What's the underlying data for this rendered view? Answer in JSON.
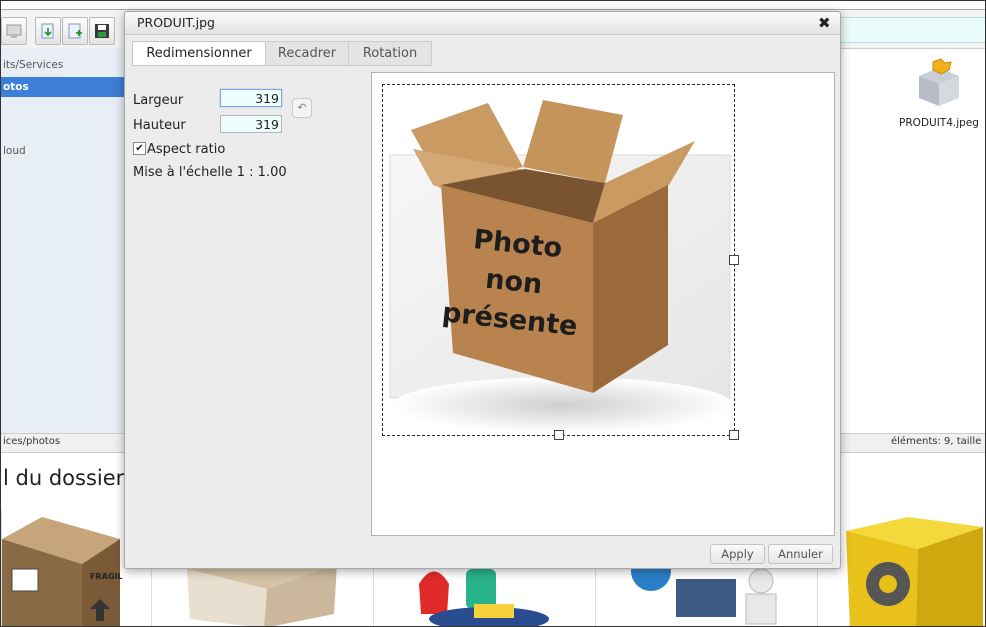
{
  "dialog": {
    "title": "PRODUIT.jpg",
    "close_glyph": "✖",
    "tabs": [
      {
        "label": "Redimensionner",
        "active": true
      },
      {
        "label": "Recadrer",
        "active": false
      },
      {
        "label": "Rotation",
        "active": false
      }
    ],
    "resize": {
      "width_label": "Largeur",
      "width_value": "319",
      "height_label": "Hauteur",
      "height_value": "319",
      "undo_icon": "undo-icon",
      "aspect_label": "Aspect ratio",
      "aspect_checked": true,
      "scale_text": "Mise à l'échelle 1 : 1.00"
    },
    "preview": {
      "caption_lines": [
        "Photo",
        "non",
        "présente"
      ]
    },
    "buttons": {
      "apply": "Apply",
      "cancel": "Annuler"
    }
  },
  "background": {
    "sidebar": {
      "items": [
        {
          "label": "its/Services",
          "active": false
        },
        {
          "label": "otos",
          "active": true
        },
        {
          "label": "loud",
          "active": false
        }
      ]
    },
    "statusbar": {
      "left": "ices/photos",
      "right": "éléments: 9, taille"
    },
    "heading": "l du dossier p",
    "right_file": {
      "name": "PRODUIT4.jpeg",
      "icon": "yellow-box-icon"
    },
    "thumbs": [
      {
        "icon": "fragile-crate-icon",
        "label": "FRAGIL"
      },
      {
        "icon": "open-box-icon"
      },
      {
        "icon": "products-icon"
      },
      {
        "icon": "laptop-user-icon"
      },
      {
        "icon": "gear-box-icon"
      }
    ]
  },
  "colors": {
    "accent": "#3d7fd6",
    "cardboard": "#b8834e",
    "input_bg": "#eefdfd"
  }
}
